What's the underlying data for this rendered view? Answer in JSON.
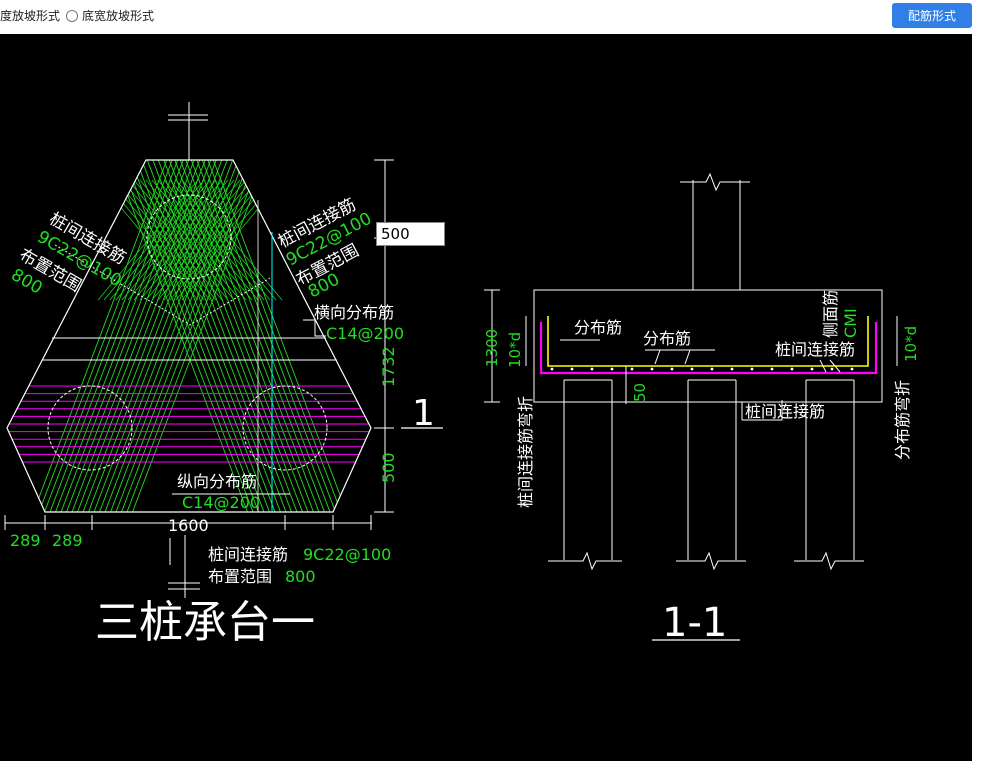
{
  "toolbar": {
    "radio1_label": "度放坡形式",
    "radio2_label": "底宽放坡形式",
    "button_label": "配筋形式"
  },
  "colors": {
    "accent": "#2f7fe6",
    "green": "#22dd22",
    "magenta": "#ff00ff",
    "yellow": "#ffff00",
    "cyan": "#00ffff",
    "white": "#ffffff"
  },
  "edit_value": "500",
  "plan": {
    "title": "三桩承台一",
    "section_mark": "1",
    "left_label_1": "桩间连接筋",
    "left_label_2": "9C22@100",
    "left_label_3": "布置范围",
    "left_label_4": "800",
    "right_label_1": "桩间连接筋",
    "right_label_2": "9C22@100",
    "right_label_3": "布置范围",
    "right_label_4": "800",
    "trans_label": "横向分布筋",
    "trans_spec": "C14@200",
    "long_label": "纵向分布筋",
    "long_spec": "C14@200",
    "bottom_label_1": "桩间连接筋",
    "bottom_label_2": "9C22@100",
    "bottom_label_3": "布置范围",
    "bottom_label_4": "800",
    "dim_1732": "1732",
    "dim_500": "500",
    "dim_1600": "1600",
    "dim_289a": "289",
    "dim_289b": "289"
  },
  "section": {
    "title": "1-1",
    "dist_label_1": "分布筋",
    "dist_label_2": "分布筋",
    "side_label": "侧面筋",
    "side_spec": "CMI",
    "conn_label_1": "桩间连接筋",
    "conn_label_2": "桩间连接筋",
    "left_vertical": "桩间连接筋弯折",
    "right_vertical": "分布筋弯折",
    "dim_1300": "1300",
    "dim_10d_left": "10*d",
    "dim_10d_right": "10*d",
    "dim_50": "50"
  }
}
